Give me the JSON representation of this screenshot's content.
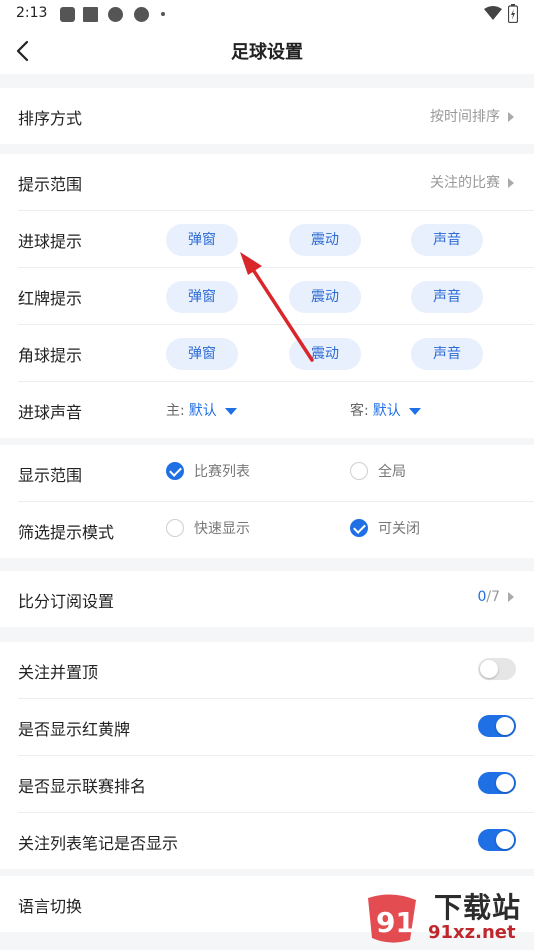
{
  "status_bar": {
    "time": "2:13"
  },
  "header": {
    "title": "足球设置",
    "back_icon": "back-chevron-icon"
  },
  "sort": {
    "label": "排序方式",
    "value": "按时间排序"
  },
  "alerts": {
    "scope": {
      "label": "提示范围",
      "value": "关注的比赛"
    },
    "goal": {
      "label": "进球提示",
      "options": [
        "弹窗",
        "震动",
        "声音"
      ]
    },
    "red_card": {
      "label": "红牌提示",
      "options": [
        "弹窗",
        "震动",
        "声音"
      ]
    },
    "corner": {
      "label": "角球提示",
      "options": [
        "弹窗",
        "震动",
        "声音"
      ]
    },
    "goal_sound": {
      "label": "进球声音",
      "home_prefix": "主:",
      "home_value": "默认",
      "away_prefix": "客:",
      "away_value": "默认"
    }
  },
  "display": {
    "scope": {
      "label": "显示范围",
      "option1": "比赛列表",
      "option1_checked": true,
      "option2": "全局",
      "option2_checked": false
    },
    "filter_mode": {
      "label": "筛选提示模式",
      "option1": "快速显示",
      "option1_checked": false,
      "option2": "可关闭",
      "option2_checked": true
    }
  },
  "subscription": {
    "label": "比分订阅设置",
    "count": "0",
    "total": "/7"
  },
  "toggles": [
    {
      "label": "关注并置顶",
      "on": false
    },
    {
      "label": "是否显示红黄牌",
      "on": true
    },
    {
      "label": "是否显示联赛排名",
      "on": true
    },
    {
      "label": "关注列表笔记是否显示",
      "on": true
    }
  ],
  "language": {
    "label": "语言切换"
  },
  "watermark": {
    "brand": "下载站",
    "domain": "91xz.net",
    "logo_text": "91"
  },
  "colors": {
    "accent": "#1f6fe5",
    "pill_bg": "#e7f0fc",
    "annotation_arrow": "#d9262b"
  }
}
